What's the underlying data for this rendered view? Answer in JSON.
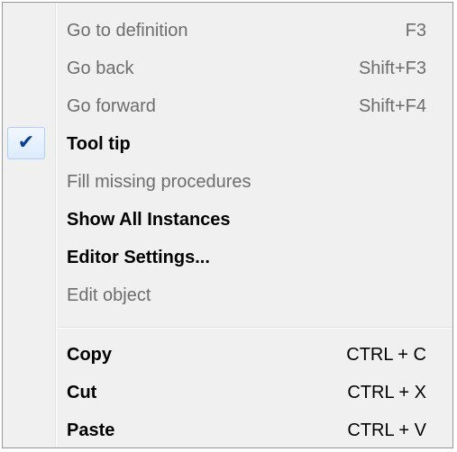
{
  "context_menu": {
    "items": [
      {
        "label": "Go to definition",
        "shortcut": "F3",
        "enabled": false
      },
      {
        "label": "Go back",
        "shortcut": "Shift+F3",
        "enabled": false
      },
      {
        "label": "Go forward",
        "shortcut": "Shift+F4",
        "enabled": false
      },
      {
        "label": "Tool tip",
        "shortcut": "",
        "enabled": true,
        "checked": true,
        "check_glyph": "✔"
      },
      {
        "label": "Fill missing procedures",
        "shortcut": "",
        "enabled": false
      },
      {
        "label": "Show All Instances",
        "shortcut": "",
        "enabled": true
      },
      {
        "label": "Editor Settings...",
        "shortcut": "",
        "enabled": true
      },
      {
        "label": "Edit object",
        "shortcut": "",
        "enabled": false
      },
      {
        "label": "Copy",
        "shortcut": "CTRL + C",
        "enabled": true
      },
      {
        "label": "Cut",
        "shortcut": "CTRL + X",
        "enabled": true
      },
      {
        "label": "Paste",
        "shortcut": "CTRL + V",
        "enabled": true
      }
    ]
  },
  "colors": {
    "menu_background": "#f0f0f0",
    "border": "#979797",
    "disabled_text": "#6d6d6d",
    "enabled_text": "#000000",
    "check_mark": "#0b3d91",
    "check_highlight_border": "#aecff7"
  }
}
